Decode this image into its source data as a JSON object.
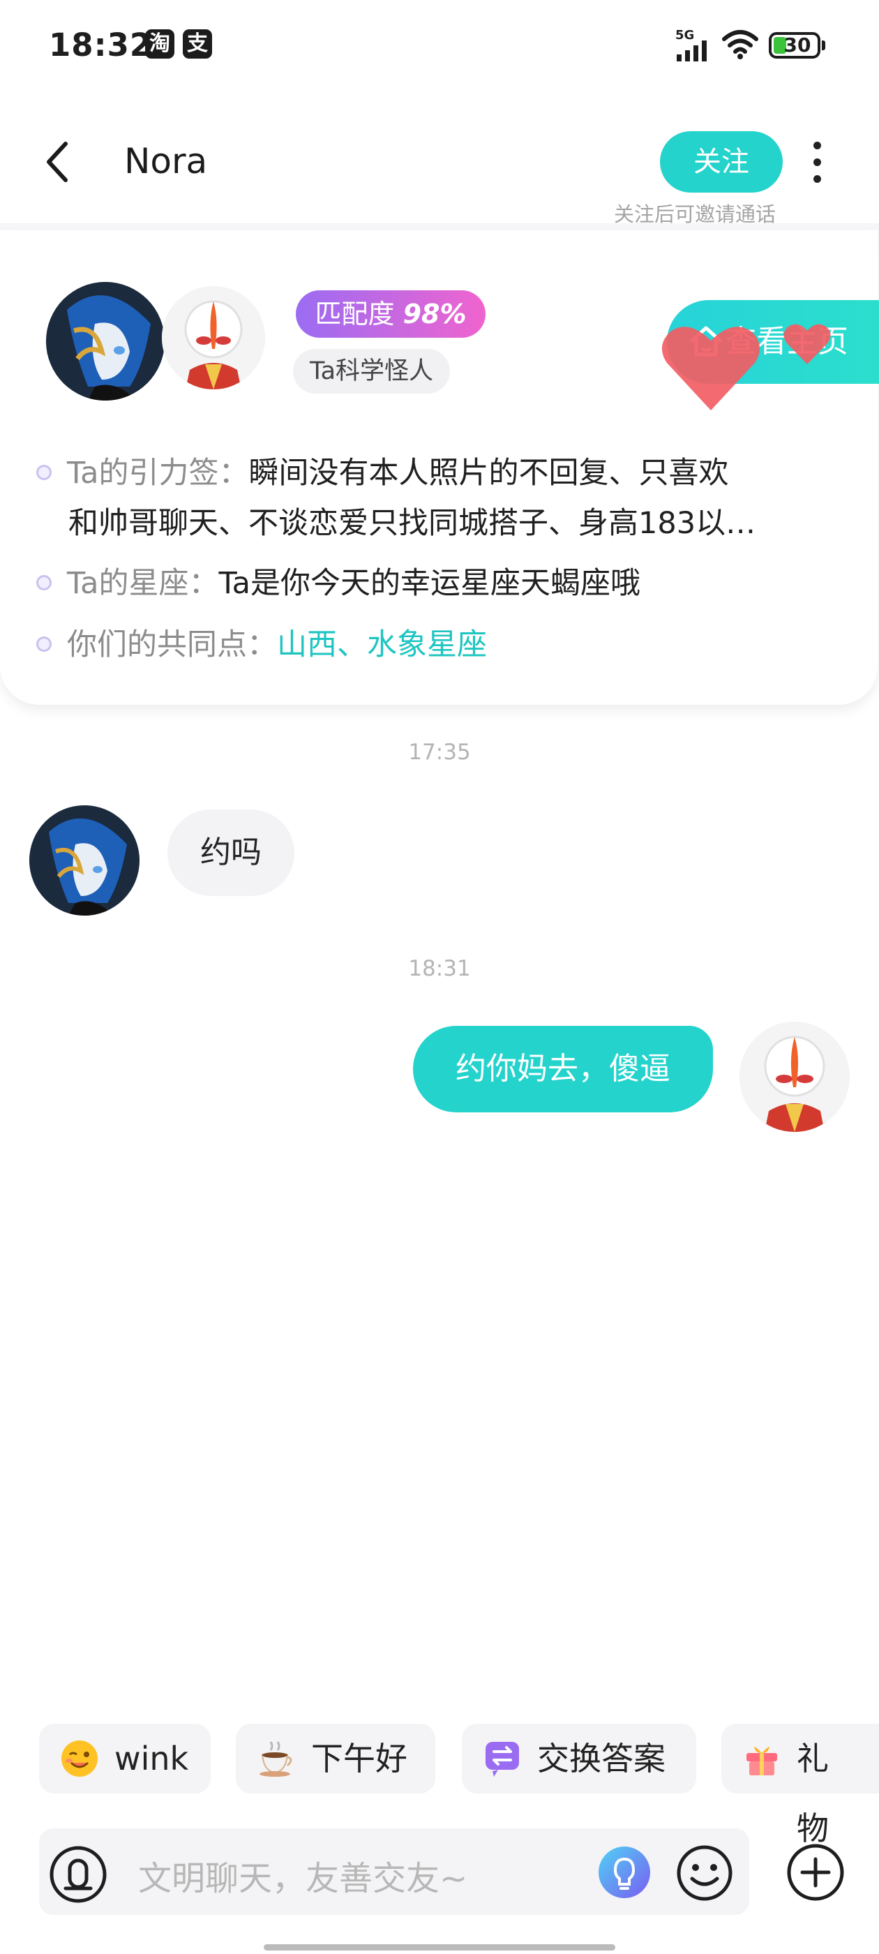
{
  "status_bar": {
    "time": "18:32",
    "apps": [
      "淘",
      "支"
    ],
    "network": "5G",
    "battery": "30"
  },
  "header": {
    "title": "Nora",
    "follow_label": "关注",
    "follow_hint": "关注后可邀请通话"
  },
  "profile": {
    "match_label": "匹配度",
    "match_value": "98%",
    "persona": "Ta科学怪人",
    "homepage_label": "查看主页",
    "tags_label": "Ta的引力签：",
    "tags_line1": "瞬间没有本人照片的不回复、只喜欢",
    "tags_line2": "和帅哥聊天、不谈恋爱只找同城搭子、身高183以…",
    "zodiac_label": "Ta的星座：",
    "zodiac_value": "Ta是你今天的幸运星座天蝎座哦",
    "common_label": "你们的共同点：",
    "common_value": "山西、水象星座"
  },
  "messages": [
    {
      "time": "17:35",
      "from": "Nora",
      "text": "约吗"
    },
    {
      "time": "18:31",
      "from": "me",
      "text": "约你妈去，傻逼"
    }
  ],
  "quick_chips": [
    {
      "icon": "wink-emoji-icon",
      "label": "wink"
    },
    {
      "icon": "coffee-icon",
      "label": "下午好"
    },
    {
      "icon": "swap-icon",
      "label": "交换答案"
    },
    {
      "icon": "gift-icon",
      "label": "礼物"
    }
  ],
  "input": {
    "placeholder": "文明聊天，友善交友~"
  },
  "colors": {
    "accent": "#24d3cc",
    "match_gradient_start": "#9b6cf3",
    "match_gradient_end": "#f064ce",
    "heart": "#f25d64"
  }
}
